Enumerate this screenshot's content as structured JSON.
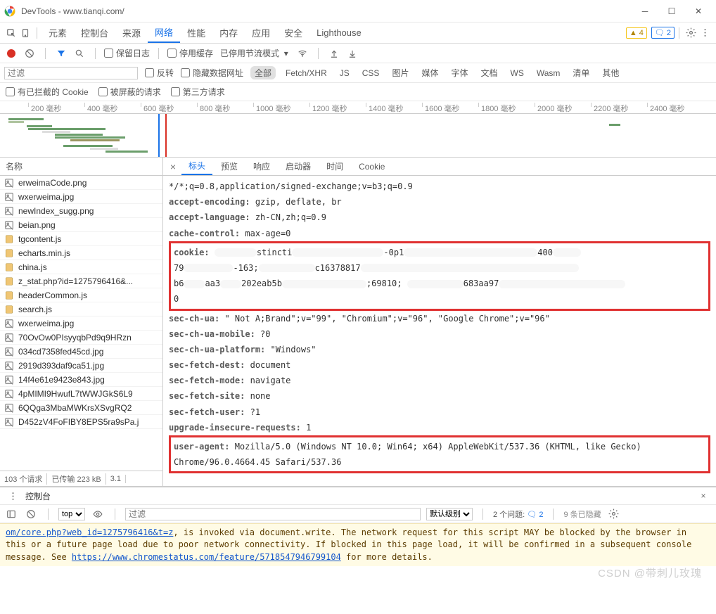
{
  "window": {
    "title": "DevTools - www.tianqi.com/"
  },
  "mainTabs": {
    "elements": "元素",
    "console": "控制台",
    "sources": "来源",
    "network": "网络",
    "performance": "性能",
    "memory": "内存",
    "application": "应用",
    "security": "安全",
    "lighthouse": "Lighthouse"
  },
  "warnings": {
    "warnCount": "4",
    "msgCount": "2"
  },
  "netToolbar": {
    "preserveLog": "保留日志",
    "disableCache": "停用缓存",
    "throttling": "已停用节流模式"
  },
  "filterBar": {
    "placeholder": "过滤",
    "invert": "反转",
    "hideDataUrls": "隐藏数据网址",
    "all": "全部",
    "fetchXhr": "Fetch/XHR",
    "js": "JS",
    "css": "CSS",
    "img": "图片",
    "media": "媒体",
    "font": "字体",
    "doc": "文档",
    "ws": "WS",
    "wasm": "Wasm",
    "manifest": "清单",
    "other": "其他"
  },
  "cookieBar": {
    "blocked": "有已拦截的 Cookie",
    "hidden": "被屏蔽的请求",
    "thirdParty": "第三方请求"
  },
  "timeline": {
    "ticks": [
      "200 毫秒",
      "400 毫秒",
      "600 毫秒",
      "800 毫秒",
      "1000 毫秒",
      "1200 毫秒",
      "1400 毫秒",
      "1600 毫秒",
      "1800 毫秒",
      "2000 毫秒",
      "2200 毫秒",
      "2400 毫秒"
    ]
  },
  "leftPanel": {
    "header": "名称",
    "rows": [
      {
        "icon": "img",
        "name": "erweimaCode.png"
      },
      {
        "icon": "img",
        "name": "wxerweima.jpg"
      },
      {
        "icon": "img",
        "name": "newIndex_sugg.png"
      },
      {
        "icon": "img",
        "name": "beian.png"
      },
      {
        "icon": "js",
        "name": "tgcontent.js"
      },
      {
        "icon": "js",
        "name": "echarts.min.js"
      },
      {
        "icon": "js",
        "name": "china.js"
      },
      {
        "icon": "js",
        "name": "z_stat.php?id=1275796416&..."
      },
      {
        "icon": "js",
        "name": "headerCommon.js"
      },
      {
        "icon": "js",
        "name": "search.js"
      },
      {
        "icon": "img",
        "name": "wxerweima.jpg"
      },
      {
        "icon": "img",
        "name": "70OvOw0PIsyyqbPd9q9HRzn"
      },
      {
        "icon": "img",
        "name": "034cd7358fed45cd.jpg"
      },
      {
        "icon": "img",
        "name": "2919d393daf9ca51.jpg"
      },
      {
        "icon": "img",
        "name": "14f4e61e9423e843.jpg"
      },
      {
        "icon": "img",
        "name": "4pMIMI9HwufL7tWWJGkS6L9"
      },
      {
        "icon": "img",
        "name": "6QQga3MbaMWKrsXSvgRQ2"
      },
      {
        "icon": "img",
        "name": "D452zV4FoFIBY8EPS5ra9sPa.j"
      }
    ],
    "footer": {
      "requests": "103 个请求",
      "transferred": "已传输 223 kB",
      "more": "3.1"
    }
  },
  "detailTabs": {
    "headers": "标头",
    "preview": "预览",
    "response": "响应",
    "initiator": "启动器",
    "timing": "时间",
    "cookies": "Cookie"
  },
  "headersList": {
    "accept_tail": "*/*;q=0.8,application/signed-exchange;v=b3;q=0.9",
    "acceptEncoding_k": "accept-encoding:",
    "acceptEncoding_v": " gzip, deflate, br",
    "acceptLanguage_k": "accept-language:",
    "acceptLanguage_v": " zh-CN,zh;q=0.9",
    "cacheControl_k": "cache-control:",
    "cacheControl_v": " max-age=0",
    "cookie_k": "cookie:",
    "secChUa_k": "sec-ch-ua:",
    "secChUa_v": " \" Not A;Brand\";v=\"99\", \"Chromium\";v=\"96\", \"Google Chrome\";v=\"96\"",
    "secChUaMobile_k": "sec-ch-ua-mobile:",
    "secChUaMobile_v": " ?0",
    "secChUaPlatform_k": "sec-ch-ua-platform:",
    "secChUaPlatform_v": " \"Windows\"",
    "secFetchDest_k": "sec-fetch-dest:",
    "secFetchDest_v": " document",
    "secFetchMode_k": "sec-fetch-mode:",
    "secFetchMode_v": " navigate",
    "secFetchSite_k": "sec-fetch-site:",
    "secFetchSite_v": " none",
    "secFetchUser_k": "sec-fetch-user:",
    "secFetchUser_v": " ?1",
    "upgrade_k": "upgrade-insecure-requests:",
    "upgrade_v": " 1",
    "userAgent_k": "user-agent:",
    "userAgent_v": " Mozilla/5.0 (Windows NT 10.0; Win64; x64) AppleWebKit/537.36 (KHTML, like Gecko) Chrome/96.0.4664.45 Safari/537.36"
  },
  "consoleDrawer": {
    "title": "控制台",
    "topSelect": "top",
    "filterPlaceholder": "过滤",
    "levelSelect": "默认级别",
    "issues": "2 个问题:",
    "issuesCount": "2",
    "hidden": "9 条已隐藏",
    "msg_a": "om/core.php?web_id=1275796416&t=z",
    "msg_b": ", is invoked via document.write. The network request for this script MAY be blocked by the browser in this or a future page load due to poor network connectivity. If blocked in this page load, it will be confirmed in a subsequent console message. See ",
    "msg_link": "https://www.chromestatus.com/feature/5718547946799104",
    "msg_c": " for more details."
  },
  "watermark": "CSDN @带刺儿玫瑰"
}
